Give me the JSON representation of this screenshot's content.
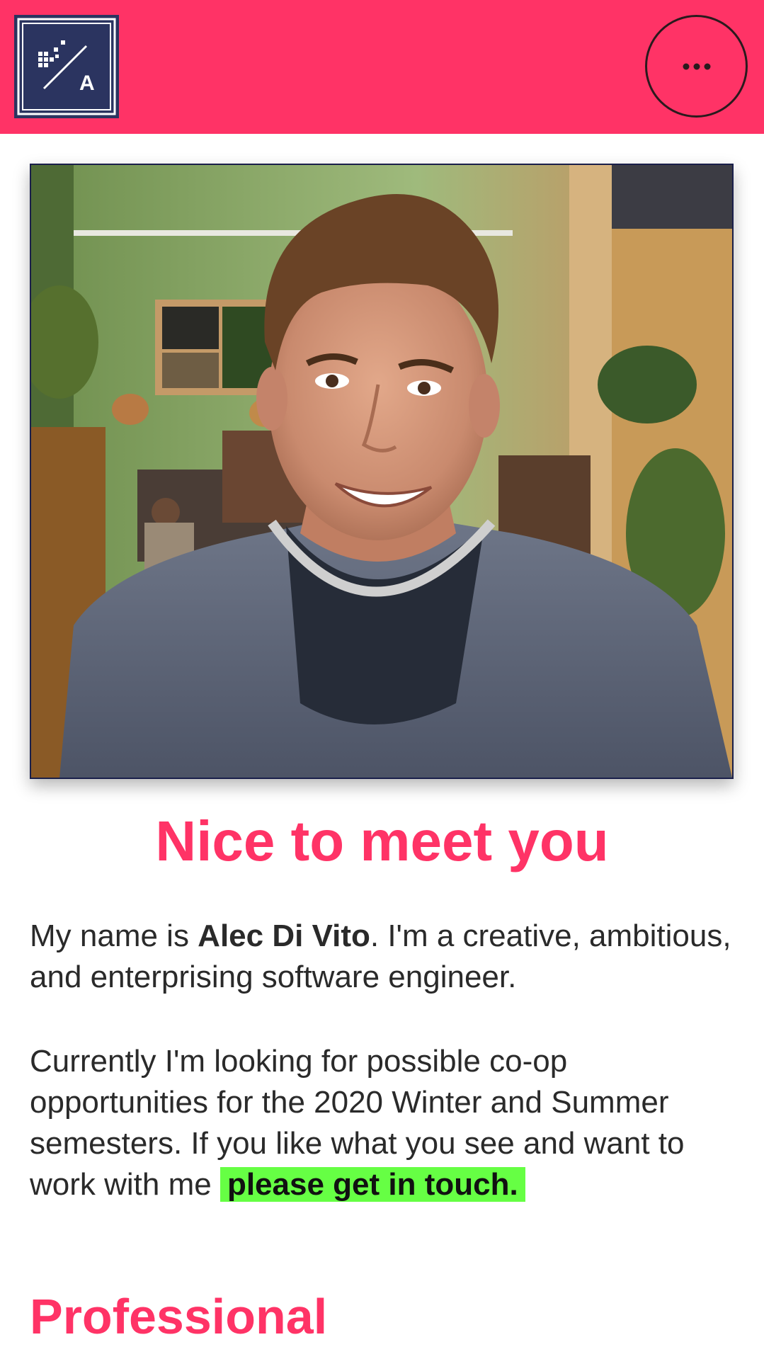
{
  "header": {
    "logo_letter": "A",
    "logo_icon": "site-logo",
    "menu_icon": "more-horizontal-icon",
    "colors": {
      "background": "#ff3366",
      "logo_bg": "#2b3460"
    }
  },
  "hero": {
    "photo_icon": "profile-photo"
  },
  "intro": {
    "headline": "Nice to meet you",
    "bio_prefix": "My name is ",
    "name": "Alec Di Vito",
    "bio_suffix": ". I'm a creative, ambitious, and enterprising software engineer.",
    "availability": "Currently I'm looking for possible co-op opportunities for the 2020 Winter and Summer semesters. If you like what you see and want to work with me",
    "contact_link": "please get in touch.",
    "colors": {
      "accent": "#ff3366",
      "highlight": "#66ff44"
    }
  },
  "sections": {
    "professional_title": "Professional"
  }
}
